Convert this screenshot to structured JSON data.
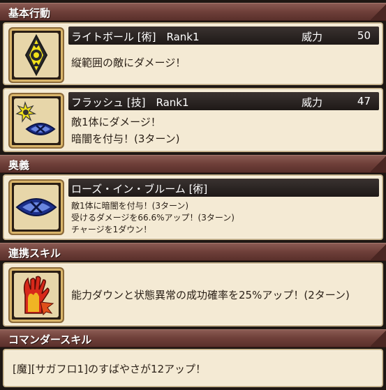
{
  "sections": {
    "basic": "基本行動",
    "ougi": "奥義",
    "renkei": "連携スキル",
    "commander": "コマンダースキル"
  },
  "skills": [
    {
      "name": "ライトボール [術]　Rank1",
      "power_label": "威力",
      "power_value": "50",
      "desc": [
        "縦範囲の敵にダメージ！"
      ],
      "icon": "light-ball-icon"
    },
    {
      "name": "フラッシュ [技]　Rank1",
      "power_label": "威力",
      "power_value": "47",
      "desc": [
        "敵1体にダメージ！",
        "暗闇を付与！(3ターン)"
      ],
      "icon": "flash-icon"
    }
  ],
  "ougi": {
    "name": "ローズ・イン・ブルーム [術]",
    "desc": [
      "敵1体に暗闇を付与！(3ターン)",
      "受けるダメージを66.6%アップ！(3ターン)",
      "チャージを1ダウン！"
    ],
    "icon": "blind-eye-icon"
  },
  "renkei": {
    "desc": "能力ダウンと状態異常の成功確率を25%アップ！(2ターン)",
    "icon": "hand-flame-icon"
  },
  "commander": {
    "desc": "[魔][サガフロ1]のすばやさが12アップ！"
  },
  "colors": {
    "header": "#6e3f39",
    "card": "#f4ead4",
    "bar": "#1e1917"
  }
}
